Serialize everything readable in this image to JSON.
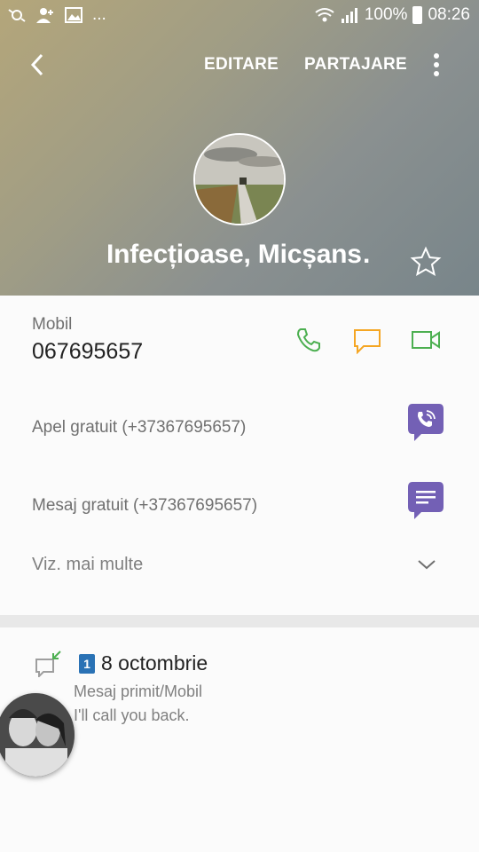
{
  "status_bar": {
    "battery": "100%",
    "time": "08:26",
    "more": "...",
    "icons": [
      "sync-icon",
      "add-contact-icon",
      "image-icon",
      "wifi-icon",
      "signal-icon",
      "battery-icon"
    ]
  },
  "toolbar": {
    "edit_label": "EDITARE",
    "share_label": "PARTAJARE",
    "icons": [
      "back-icon",
      "more-vert-icon"
    ]
  },
  "contact": {
    "name": "Infecțioase, Micșans…"
  },
  "phone": {
    "label": "Mobil",
    "number": "067695657"
  },
  "viber": {
    "call_label": "Apel gratuit (+37367695657)",
    "message_label": "Mesaj gratuit (+37367695657)"
  },
  "see_more_label": "Viz. mai multe",
  "history": {
    "sim": "1",
    "date": "8 octombrie",
    "type": "Mesaj primit/Mobil",
    "text": "I'll call you back."
  },
  "colors": {
    "call_green": "#4caf50",
    "message_orange": "#f5a623",
    "viber_purple": "#7360b5",
    "sim_blue": "#2a72b5"
  }
}
